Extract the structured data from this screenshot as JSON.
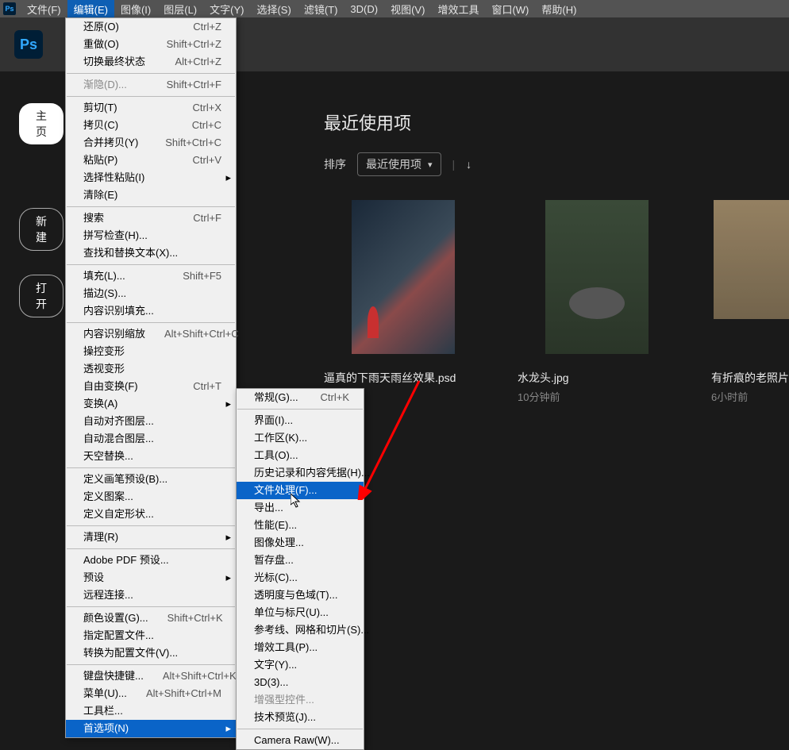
{
  "menubar": {
    "items": [
      "文件(F)",
      "编辑(E)",
      "图像(I)",
      "图层(L)",
      "文字(Y)",
      "选择(S)",
      "滤镜(T)",
      "3D(D)",
      "视图(V)",
      "增效工具",
      "窗口(W)",
      "帮助(H)"
    ]
  },
  "sidebar": {
    "home": "主页",
    "new": "新建",
    "open": "打开"
  },
  "content": {
    "title": "最近使用项",
    "sort_label": "排序",
    "sort_value": "最近使用项",
    "files": [
      {
        "name": "逼真的下雨天雨丝效果.psd",
        "time": ""
      },
      {
        "name": "水龙头.jpg",
        "time": "10分钟前"
      },
      {
        "name": "有折痕的老照片.jpg",
        "time": "6小时前"
      }
    ]
  },
  "edit_menu": [
    {
      "label": "还原(O)",
      "sc": "Ctrl+Z"
    },
    {
      "label": "重做(O)",
      "sc": "Shift+Ctrl+Z"
    },
    {
      "label": "切换最终状态",
      "sc": "Alt+Ctrl+Z"
    },
    {
      "sep": true
    },
    {
      "label": "渐隐(D)...",
      "sc": "Shift+Ctrl+F",
      "dis": true
    },
    {
      "sep": true
    },
    {
      "label": "剪切(T)",
      "sc": "Ctrl+X"
    },
    {
      "label": "拷贝(C)",
      "sc": "Ctrl+C"
    },
    {
      "label": "合并拷贝(Y)",
      "sc": "Shift+Ctrl+C"
    },
    {
      "label": "粘贴(P)",
      "sc": "Ctrl+V"
    },
    {
      "label": "选择性粘贴(I)",
      "sub": true
    },
    {
      "label": "清除(E)"
    },
    {
      "sep": true
    },
    {
      "label": "搜索",
      "sc": "Ctrl+F"
    },
    {
      "label": "拼写检查(H)..."
    },
    {
      "label": "查找和替换文本(X)..."
    },
    {
      "sep": true
    },
    {
      "label": "填充(L)...",
      "sc": "Shift+F5"
    },
    {
      "label": "描边(S)..."
    },
    {
      "label": "内容识别填充..."
    },
    {
      "sep": true
    },
    {
      "label": "内容识别缩放",
      "sc": "Alt+Shift+Ctrl+C"
    },
    {
      "label": "操控变形"
    },
    {
      "label": "透视变形"
    },
    {
      "label": "自由变换(F)",
      "sc": "Ctrl+T"
    },
    {
      "label": "变换(A)",
      "sub": true
    },
    {
      "label": "自动对齐图层..."
    },
    {
      "label": "自动混合图层..."
    },
    {
      "label": "天空替换..."
    },
    {
      "sep": true
    },
    {
      "label": "定义画笔预设(B)..."
    },
    {
      "label": "定义图案..."
    },
    {
      "label": "定义自定形状..."
    },
    {
      "sep": true
    },
    {
      "label": "清理(R)",
      "sub": true
    },
    {
      "sep": true
    },
    {
      "label": "Adobe PDF 预设..."
    },
    {
      "label": "预设",
      "sub": true
    },
    {
      "label": "远程连接..."
    },
    {
      "sep": true
    },
    {
      "label": "颜色设置(G)...",
      "sc": "Shift+Ctrl+K"
    },
    {
      "label": "指定配置文件..."
    },
    {
      "label": "转换为配置文件(V)..."
    },
    {
      "sep": true
    },
    {
      "label": "键盘快捷键...",
      "sc": "Alt+Shift+Ctrl+K"
    },
    {
      "label": "菜单(U)...",
      "sc": "Alt+Shift+Ctrl+M"
    },
    {
      "label": "工具栏..."
    },
    {
      "label": "首选项(N)",
      "sub": true,
      "hov": true
    }
  ],
  "pref_menu": [
    {
      "label": "常规(G)...",
      "sc": "Ctrl+K"
    },
    {
      "sep": true
    },
    {
      "label": "界面(I)..."
    },
    {
      "label": "工作区(K)..."
    },
    {
      "label": "工具(O)..."
    },
    {
      "label": "历史记录和内容凭据(H)..."
    },
    {
      "label": "文件处理(F)...",
      "hov": true
    },
    {
      "label": "导出..."
    },
    {
      "label": "性能(E)..."
    },
    {
      "label": "图像处理..."
    },
    {
      "label": "暂存盘..."
    },
    {
      "label": "光标(C)..."
    },
    {
      "label": "透明度与色域(T)..."
    },
    {
      "label": "单位与标尺(U)..."
    },
    {
      "label": "参考线、网格和切片(S)..."
    },
    {
      "label": "增效工具(P)..."
    },
    {
      "label": "文字(Y)..."
    },
    {
      "label": "3D(3)..."
    },
    {
      "label": "增强型控件...",
      "dis": true
    },
    {
      "label": "技术预览(J)..."
    },
    {
      "sep": true
    },
    {
      "label": "Camera Raw(W)..."
    }
  ]
}
